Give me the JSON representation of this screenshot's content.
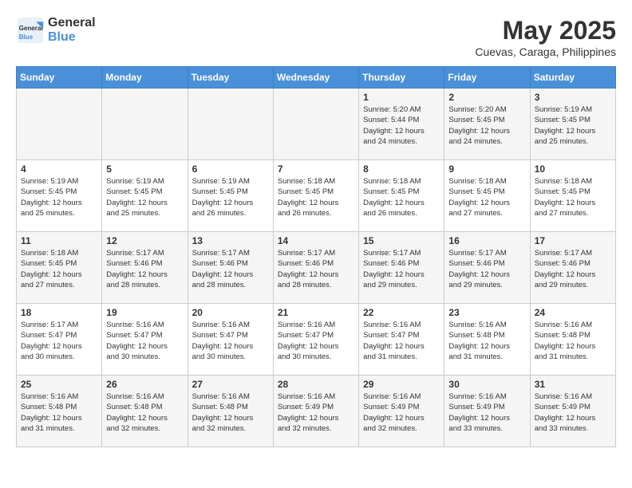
{
  "header": {
    "logo_line1": "General",
    "logo_line2": "Blue",
    "month_title": "May 2025",
    "location": "Cuevas, Caraga, Philippines"
  },
  "days_of_week": [
    "Sunday",
    "Monday",
    "Tuesday",
    "Wednesday",
    "Thursday",
    "Friday",
    "Saturday"
  ],
  "weeks": [
    [
      {
        "day": "",
        "info": ""
      },
      {
        "day": "",
        "info": ""
      },
      {
        "day": "",
        "info": ""
      },
      {
        "day": "",
        "info": ""
      },
      {
        "day": "1",
        "info": "Sunrise: 5:20 AM\nSunset: 5:44 PM\nDaylight: 12 hours\nand 24 minutes."
      },
      {
        "day": "2",
        "info": "Sunrise: 5:20 AM\nSunset: 5:45 PM\nDaylight: 12 hours\nand 24 minutes."
      },
      {
        "day": "3",
        "info": "Sunrise: 5:19 AM\nSunset: 5:45 PM\nDaylight: 12 hours\nand 25 minutes."
      }
    ],
    [
      {
        "day": "4",
        "info": "Sunrise: 5:19 AM\nSunset: 5:45 PM\nDaylight: 12 hours\nand 25 minutes."
      },
      {
        "day": "5",
        "info": "Sunrise: 5:19 AM\nSunset: 5:45 PM\nDaylight: 12 hours\nand 25 minutes."
      },
      {
        "day": "6",
        "info": "Sunrise: 5:19 AM\nSunset: 5:45 PM\nDaylight: 12 hours\nand 26 minutes."
      },
      {
        "day": "7",
        "info": "Sunrise: 5:18 AM\nSunset: 5:45 PM\nDaylight: 12 hours\nand 26 minutes."
      },
      {
        "day": "8",
        "info": "Sunrise: 5:18 AM\nSunset: 5:45 PM\nDaylight: 12 hours\nand 26 minutes."
      },
      {
        "day": "9",
        "info": "Sunrise: 5:18 AM\nSunset: 5:45 PM\nDaylight: 12 hours\nand 27 minutes."
      },
      {
        "day": "10",
        "info": "Sunrise: 5:18 AM\nSunset: 5:45 PM\nDaylight: 12 hours\nand 27 minutes."
      }
    ],
    [
      {
        "day": "11",
        "info": "Sunrise: 5:18 AM\nSunset: 5:45 PM\nDaylight: 12 hours\nand 27 minutes."
      },
      {
        "day": "12",
        "info": "Sunrise: 5:17 AM\nSunset: 5:46 PM\nDaylight: 12 hours\nand 28 minutes."
      },
      {
        "day": "13",
        "info": "Sunrise: 5:17 AM\nSunset: 5:46 PM\nDaylight: 12 hours\nand 28 minutes."
      },
      {
        "day": "14",
        "info": "Sunrise: 5:17 AM\nSunset: 5:46 PM\nDaylight: 12 hours\nand 28 minutes."
      },
      {
        "day": "15",
        "info": "Sunrise: 5:17 AM\nSunset: 5:46 PM\nDaylight: 12 hours\nand 29 minutes."
      },
      {
        "day": "16",
        "info": "Sunrise: 5:17 AM\nSunset: 5:46 PM\nDaylight: 12 hours\nand 29 minutes."
      },
      {
        "day": "17",
        "info": "Sunrise: 5:17 AM\nSunset: 5:46 PM\nDaylight: 12 hours\nand 29 minutes."
      }
    ],
    [
      {
        "day": "18",
        "info": "Sunrise: 5:17 AM\nSunset: 5:47 PM\nDaylight: 12 hours\nand 30 minutes."
      },
      {
        "day": "19",
        "info": "Sunrise: 5:16 AM\nSunset: 5:47 PM\nDaylight: 12 hours\nand 30 minutes."
      },
      {
        "day": "20",
        "info": "Sunrise: 5:16 AM\nSunset: 5:47 PM\nDaylight: 12 hours\nand 30 minutes."
      },
      {
        "day": "21",
        "info": "Sunrise: 5:16 AM\nSunset: 5:47 PM\nDaylight: 12 hours\nand 30 minutes."
      },
      {
        "day": "22",
        "info": "Sunrise: 5:16 AM\nSunset: 5:47 PM\nDaylight: 12 hours\nand 31 minutes."
      },
      {
        "day": "23",
        "info": "Sunrise: 5:16 AM\nSunset: 5:48 PM\nDaylight: 12 hours\nand 31 minutes."
      },
      {
        "day": "24",
        "info": "Sunrise: 5:16 AM\nSunset: 5:48 PM\nDaylight: 12 hours\nand 31 minutes."
      }
    ],
    [
      {
        "day": "25",
        "info": "Sunrise: 5:16 AM\nSunset: 5:48 PM\nDaylight: 12 hours\nand 31 minutes."
      },
      {
        "day": "26",
        "info": "Sunrise: 5:16 AM\nSunset: 5:48 PM\nDaylight: 12 hours\nand 32 minutes."
      },
      {
        "day": "27",
        "info": "Sunrise: 5:16 AM\nSunset: 5:48 PM\nDaylight: 12 hours\nand 32 minutes."
      },
      {
        "day": "28",
        "info": "Sunrise: 5:16 AM\nSunset: 5:49 PM\nDaylight: 12 hours\nand 32 minutes."
      },
      {
        "day": "29",
        "info": "Sunrise: 5:16 AM\nSunset: 5:49 PM\nDaylight: 12 hours\nand 32 minutes."
      },
      {
        "day": "30",
        "info": "Sunrise: 5:16 AM\nSunset: 5:49 PM\nDaylight: 12 hours\nand 33 minutes."
      },
      {
        "day": "31",
        "info": "Sunrise: 5:16 AM\nSunset: 5:49 PM\nDaylight: 12 hours\nand 33 minutes."
      }
    ]
  ]
}
